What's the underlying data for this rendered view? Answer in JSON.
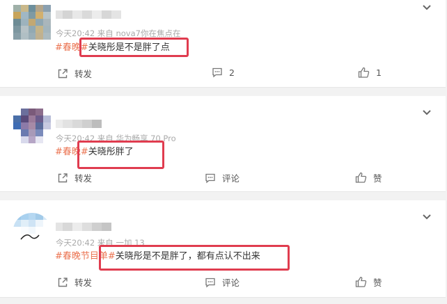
{
  "posts": [
    {
      "meta": "今天20:42  来自 nova7你在焦点在",
      "topic": "#春晚#",
      "text": "关晓彤是不是胖了点",
      "actions": {
        "repost": "转发",
        "comment": "2",
        "like": "1"
      },
      "avatar_colors": [
        "#9fb0a8",
        "#c9b88a",
        "#6d8f9c",
        "#b3a58b",
        "#8aa0b0",
        "#c7a45a",
        "#a0b7c4",
        "#7f9aa3",
        "#d2b06e",
        "#b8c4c9",
        "#6e8c95",
        "#9db3bd",
        "#c2a872",
        "#8fa6b1",
        "#aab6bb",
        "#7d97a0",
        "#b6c2c6",
        "#92a9b2",
        "#c4b48a",
        "#a4b5bc",
        "#889fa8",
        "#b0bfc4",
        "#9aaeb6",
        "#c0b190",
        "#acbbc0"
      ]
    },
    {
      "meta": "今天20:42  来自 华为畅享 70 Pro",
      "topic": "#春晚#",
      "text": "关晓彤胖了",
      "actions": {
        "repost": "转发",
        "comment": "评论",
        "like": "赞"
      },
      "avatar_colors": [
        "#ffffff",
        "#6b6f9c",
        "#7a5a7a",
        "#8c6d8c",
        "#ffffff",
        "#4a6fa8",
        "#5a4a7a",
        "#9a7a9a",
        "#6b5b8b",
        "#b7bcd7",
        "#3f6cb3",
        "#8c7aa8",
        "#a68aa6",
        "#5b6b9b",
        "#c7c9e0",
        "#ffffff",
        "#6a7ab0",
        "#a89ab8",
        "#7b8bbb",
        "#ffffff",
        "#ffffff",
        "#d8d9ec",
        "#b6a6c6",
        "#e6e6f2",
        "#ffffff"
      ]
    },
    {
      "meta": "今天20:42  来自 一加 13",
      "topic": "#春晚节目单#",
      "text": "关晓彤是不是胖了，都有点认不出来",
      "actions": {
        "repost": "转发",
        "comment": "评论",
        "like": "赞"
      },
      "avatar_colors": [
        "#9ec9ea",
        "#a9d1ef",
        "#b5d7f1",
        "#a3cbe9",
        "#d6e8f6",
        "#c8e1f4",
        "#e0eef8",
        "#cfe4f5",
        "#eef5fb",
        "#ffffff",
        "#ffffff",
        "#fafcfe",
        "#f3f8fc",
        "#ffffff",
        "#ffffff",
        "#ffffff",
        "#ffffff",
        "#ffffff",
        "#ffffff",
        "#ffffff",
        "#ffffff",
        "#ffffff",
        "#ffffff",
        "#ffffff",
        "#ffffff"
      ]
    }
  ],
  "colors": {
    "tag": "#eb7350",
    "highlight": "#e03c4f"
  },
  "icons": {
    "repost": "share-box-icon",
    "comment": "comment-bubble-icon",
    "like": "thumbs-up-icon",
    "menu": "chevron-down-icon"
  }
}
